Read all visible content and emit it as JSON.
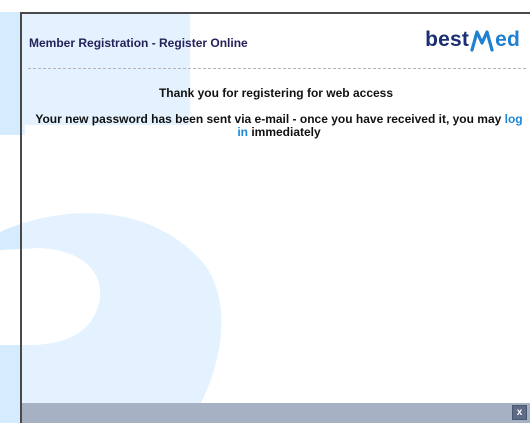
{
  "dialog": {
    "title": "Member Registration - Register Online"
  },
  "logo": {
    "part1": "best",
    "part2": "ed",
    "brand_color_dark": "#1b2f73",
    "brand_color_accent": "#1f7fd0"
  },
  "content": {
    "thank_you": "Thank you for registering for web access",
    "password_text": "Your new password has been sent via e-mail - once you have received it, you may ",
    "login_link": "log in",
    "password_text_end": " immediately"
  },
  "footer": {
    "close_label": "x"
  },
  "colors": {
    "background_shape": "#d9efff",
    "footer_bar": "#a7b1c4"
  }
}
